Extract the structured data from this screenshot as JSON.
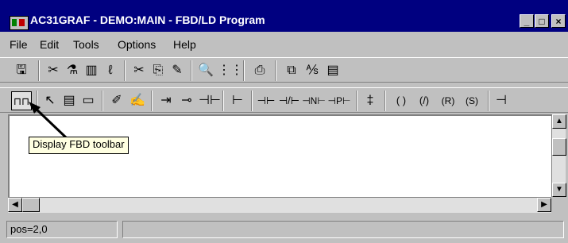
{
  "window": {
    "title": "AC31GRAF - DEMO:MAIN - FBD/LD Program",
    "controls": {
      "minimize": "_",
      "maximize": "□",
      "close": "×"
    }
  },
  "menu": [
    "File",
    "Edit",
    "Tools",
    "Options",
    "Help"
  ],
  "toolbar1": [
    {
      "name": "save-icon",
      "glyph": "🖫"
    },
    {
      "name": "cut-scissors-icon",
      "glyph": "✂"
    },
    {
      "name": "tool-a-icon",
      "glyph": "⚗"
    },
    {
      "name": "library-icon",
      "glyph": "▥"
    },
    {
      "name": "variables-icon",
      "glyph": "ℓ"
    },
    {
      "name": "cut-icon",
      "glyph": "✂"
    },
    {
      "name": "copy-icon",
      "glyph": "⎘"
    },
    {
      "name": "paste-icon",
      "glyph": "✎"
    },
    {
      "name": "find-icon",
      "glyph": "🔍"
    },
    {
      "name": "grid-icon",
      "glyph": "⋮⋮"
    },
    {
      "name": "print-icon",
      "glyph": "⎙"
    },
    {
      "name": "compile-icon",
      "glyph": "⧉"
    },
    {
      "name": "translate-icon",
      "glyph": "⅍"
    },
    {
      "name": "monitor-icon",
      "glyph": "▤"
    }
  ],
  "toolbar2": [
    {
      "name": "display-fbd-toolbar-button",
      "glyph": "⊓⊓",
      "pressed": true
    },
    {
      "name": "select-arrow-icon",
      "glyph": "↖"
    },
    {
      "name": "block-icon",
      "glyph": "▤"
    },
    {
      "name": "variable-box-icon",
      "glyph": "▭"
    },
    {
      "name": "link-icon",
      "glyph": "✐"
    },
    {
      "name": "corner-icon",
      "glyph": "✍"
    },
    {
      "name": "jump-icon",
      "glyph": "⇥"
    },
    {
      "name": "label-icon",
      "glyph": "⊸"
    },
    {
      "name": "return-icon",
      "glyph": "⊣⊢"
    },
    {
      "name": "left-rail-icon",
      "glyph": "⊢"
    },
    {
      "name": "contact-no-icon",
      "glyph": "⊣⊢"
    },
    {
      "name": "contact-nc-icon",
      "glyph": "⊣/⊢"
    },
    {
      "name": "contact-n-icon",
      "glyph": "⊣N⊢"
    },
    {
      "name": "contact-p-icon",
      "glyph": "⊣P⊢"
    },
    {
      "name": "parallel-contact-icon",
      "glyph": "‡"
    },
    {
      "name": "coil-icon",
      "glyph": "( )"
    },
    {
      "name": "coil-negated-icon",
      "glyph": "(/)"
    },
    {
      "name": "coil-reset-icon",
      "glyph": "(R)"
    },
    {
      "name": "coil-set-icon",
      "glyph": "(S)"
    },
    {
      "name": "right-rail-icon",
      "glyph": "⊣"
    }
  ],
  "tooltip": "Display FBD toolbar",
  "status": {
    "position": "pos=2,0",
    "message": ""
  }
}
